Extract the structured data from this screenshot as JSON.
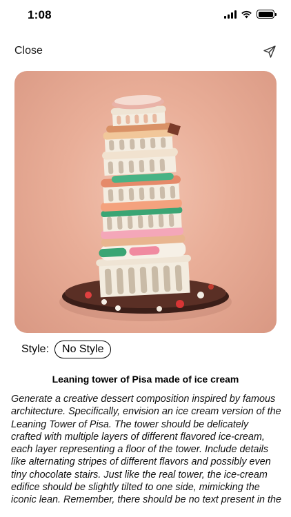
{
  "status_bar": {
    "time": "1:08"
  },
  "nav": {
    "close_label": "Close"
  },
  "image": {
    "alt": "Leaning tower of Pisa made of ice cream"
  },
  "style": {
    "label": "Style:",
    "value": "No Style"
  },
  "prompt": {
    "title": "Leaning tower of Pisa made of ice cream",
    "body": "Generate a creative dessert composition inspired by famous architecture. Specifically, envision an ice cream version of the Leaning Tower of Pisa. The tower should be delicately crafted with multiple layers of different flavored ice-cream, each layer representing a floor of the tower. Include details like alternating stripes of different flavors and possibly even tiny chocolate stairs. Just like the real tower, the ice-cream edifice should be slightly tilted to one side, mimicking the iconic lean. Remember, there should be no text present in the"
  }
}
